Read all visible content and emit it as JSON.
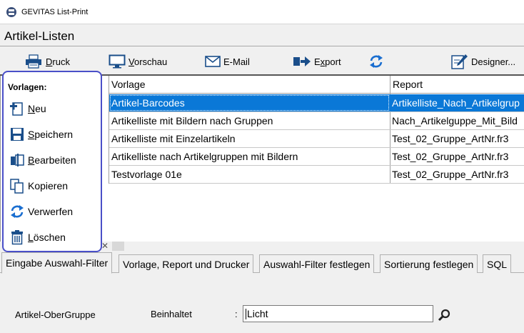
{
  "window": {
    "title": "GEVITAS List-Print"
  },
  "header": {
    "title": "Artikel-Listen"
  },
  "toolbar": {
    "print": {
      "u": "D",
      "rest": "ruck"
    },
    "preview": {
      "u": "V",
      "rest": "orschau"
    },
    "email": {
      "label": "E-Mail"
    },
    "export": {
      "pre": "E",
      "u": "x",
      "rest": "port"
    },
    "designer": {
      "label": "Designer..."
    }
  },
  "grid": {
    "headers": [
      "Vorlage",
      "Report"
    ],
    "rows": [
      {
        "vorlage": "Artikel-Barcodes",
        "report": "Artikelliste_Nach_Artikelgrup",
        "selected": true
      },
      {
        "vorlage": "Artikelliste mit Bildern nach Gruppen",
        "report": "Nach_Artikelguppe_Mit_Bild",
        "selected": false
      },
      {
        "vorlage": "Artikelliste mit Einzelartikeln",
        "report": "Test_02_Gruppe_ArtNr.fr3",
        "selected": false
      },
      {
        "vorlage": "Artikelliste nach Artikelgruppen mit Bildern",
        "report": "Test_02_Gruppe_ArtNr.fr3",
        "selected": false
      },
      {
        "vorlage": "Testvorlage 01e",
        "report": "Test_02_Gruppe_ArtNr.fr3",
        "selected": false
      }
    ]
  },
  "popup": {
    "title": "Vorlagen:",
    "items": [
      {
        "u": "N",
        "rest": "eu"
      },
      {
        "u": "S",
        "rest": "peichern"
      },
      {
        "u": "B",
        "rest": "earbeiten"
      },
      {
        "u": "",
        "rest": "Kopieren"
      },
      {
        "u": "",
        "rest": "Verwerfen"
      },
      {
        "u": "L",
        "rest": "öschen"
      }
    ]
  },
  "splitter": {
    "close": "✕"
  },
  "tabs": [
    {
      "label": "Eingabe Auswahl-Filter",
      "active": true
    },
    {
      "label": "Vorlage, Report und Drucker",
      "active": false
    },
    {
      "label": "Auswahl-Filter festlegen",
      "active": false
    },
    {
      "label": "Sortierung festlegen",
      "active": false
    },
    {
      "label": "SQL",
      "active": false
    }
  ],
  "filter": {
    "field": "Artikel-OberGruppe",
    "operator": "Beinhaltet",
    "colon": ":",
    "value": "Licht"
  },
  "colors": {
    "accent": "#0a78d7",
    "popup_border": "#4a4fc8"
  }
}
